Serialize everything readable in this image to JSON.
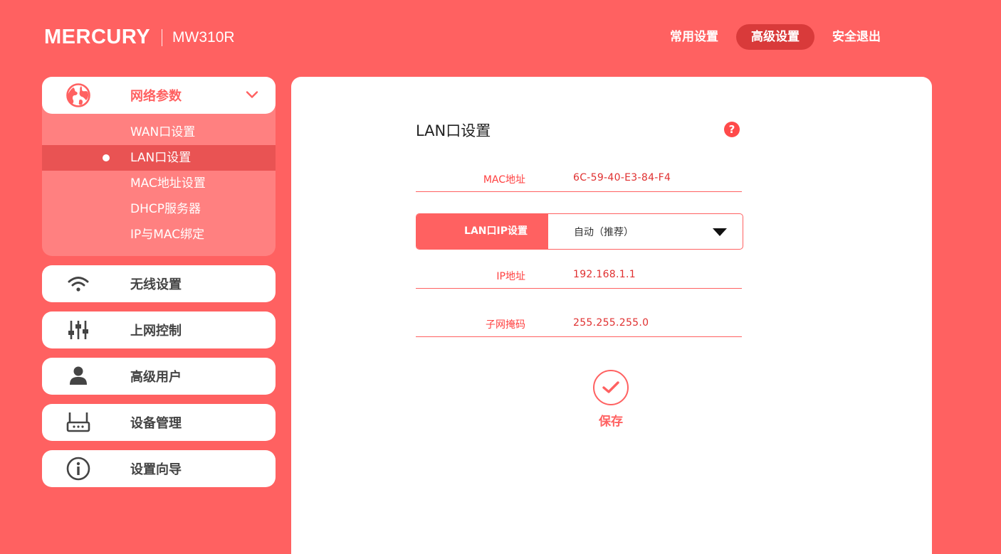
{
  "header": {
    "logo": "MERCURY",
    "model": "MW310R",
    "nav": [
      {
        "label": "常用设置",
        "active": false
      },
      {
        "label": "高级设置",
        "active": true
      },
      {
        "label": "安全退出",
        "active": false
      }
    ]
  },
  "sidebar": {
    "open_group": {
      "label": "网络参数",
      "icon": "globe-icon",
      "items": [
        "WAN口设置",
        "LAN口设置",
        "MAC地址设置",
        "DHCP服务器",
        "IP与MAC绑定"
      ],
      "active_index": 1
    },
    "groups": [
      {
        "label": "无线设置",
        "icon": "wifi-icon"
      },
      {
        "label": "上网控制",
        "icon": "sliders-icon"
      },
      {
        "label": "高级用户",
        "icon": "user-icon"
      },
      {
        "label": "设备管理",
        "icon": "router-icon"
      },
      {
        "label": "设置向导",
        "icon": "info-icon"
      }
    ]
  },
  "main": {
    "title": "LAN口设置",
    "help_icon": "?",
    "mac_label": "MAC地址",
    "mac_value": "6C-59-40-E3-84-F4",
    "ip_setting_label": "LAN口IP设置",
    "ip_setting_value": "自动（推荐）",
    "ip_label": "IP地址",
    "ip_value": "192.168.1.1",
    "mask_label": "子网掩码",
    "mask_value": "255.255.255.0",
    "save_label": "保存"
  },
  "colors": {
    "brand": "#ff6161",
    "active_tab": "#d93a3a",
    "submenu_bg": "#ff8080"
  }
}
